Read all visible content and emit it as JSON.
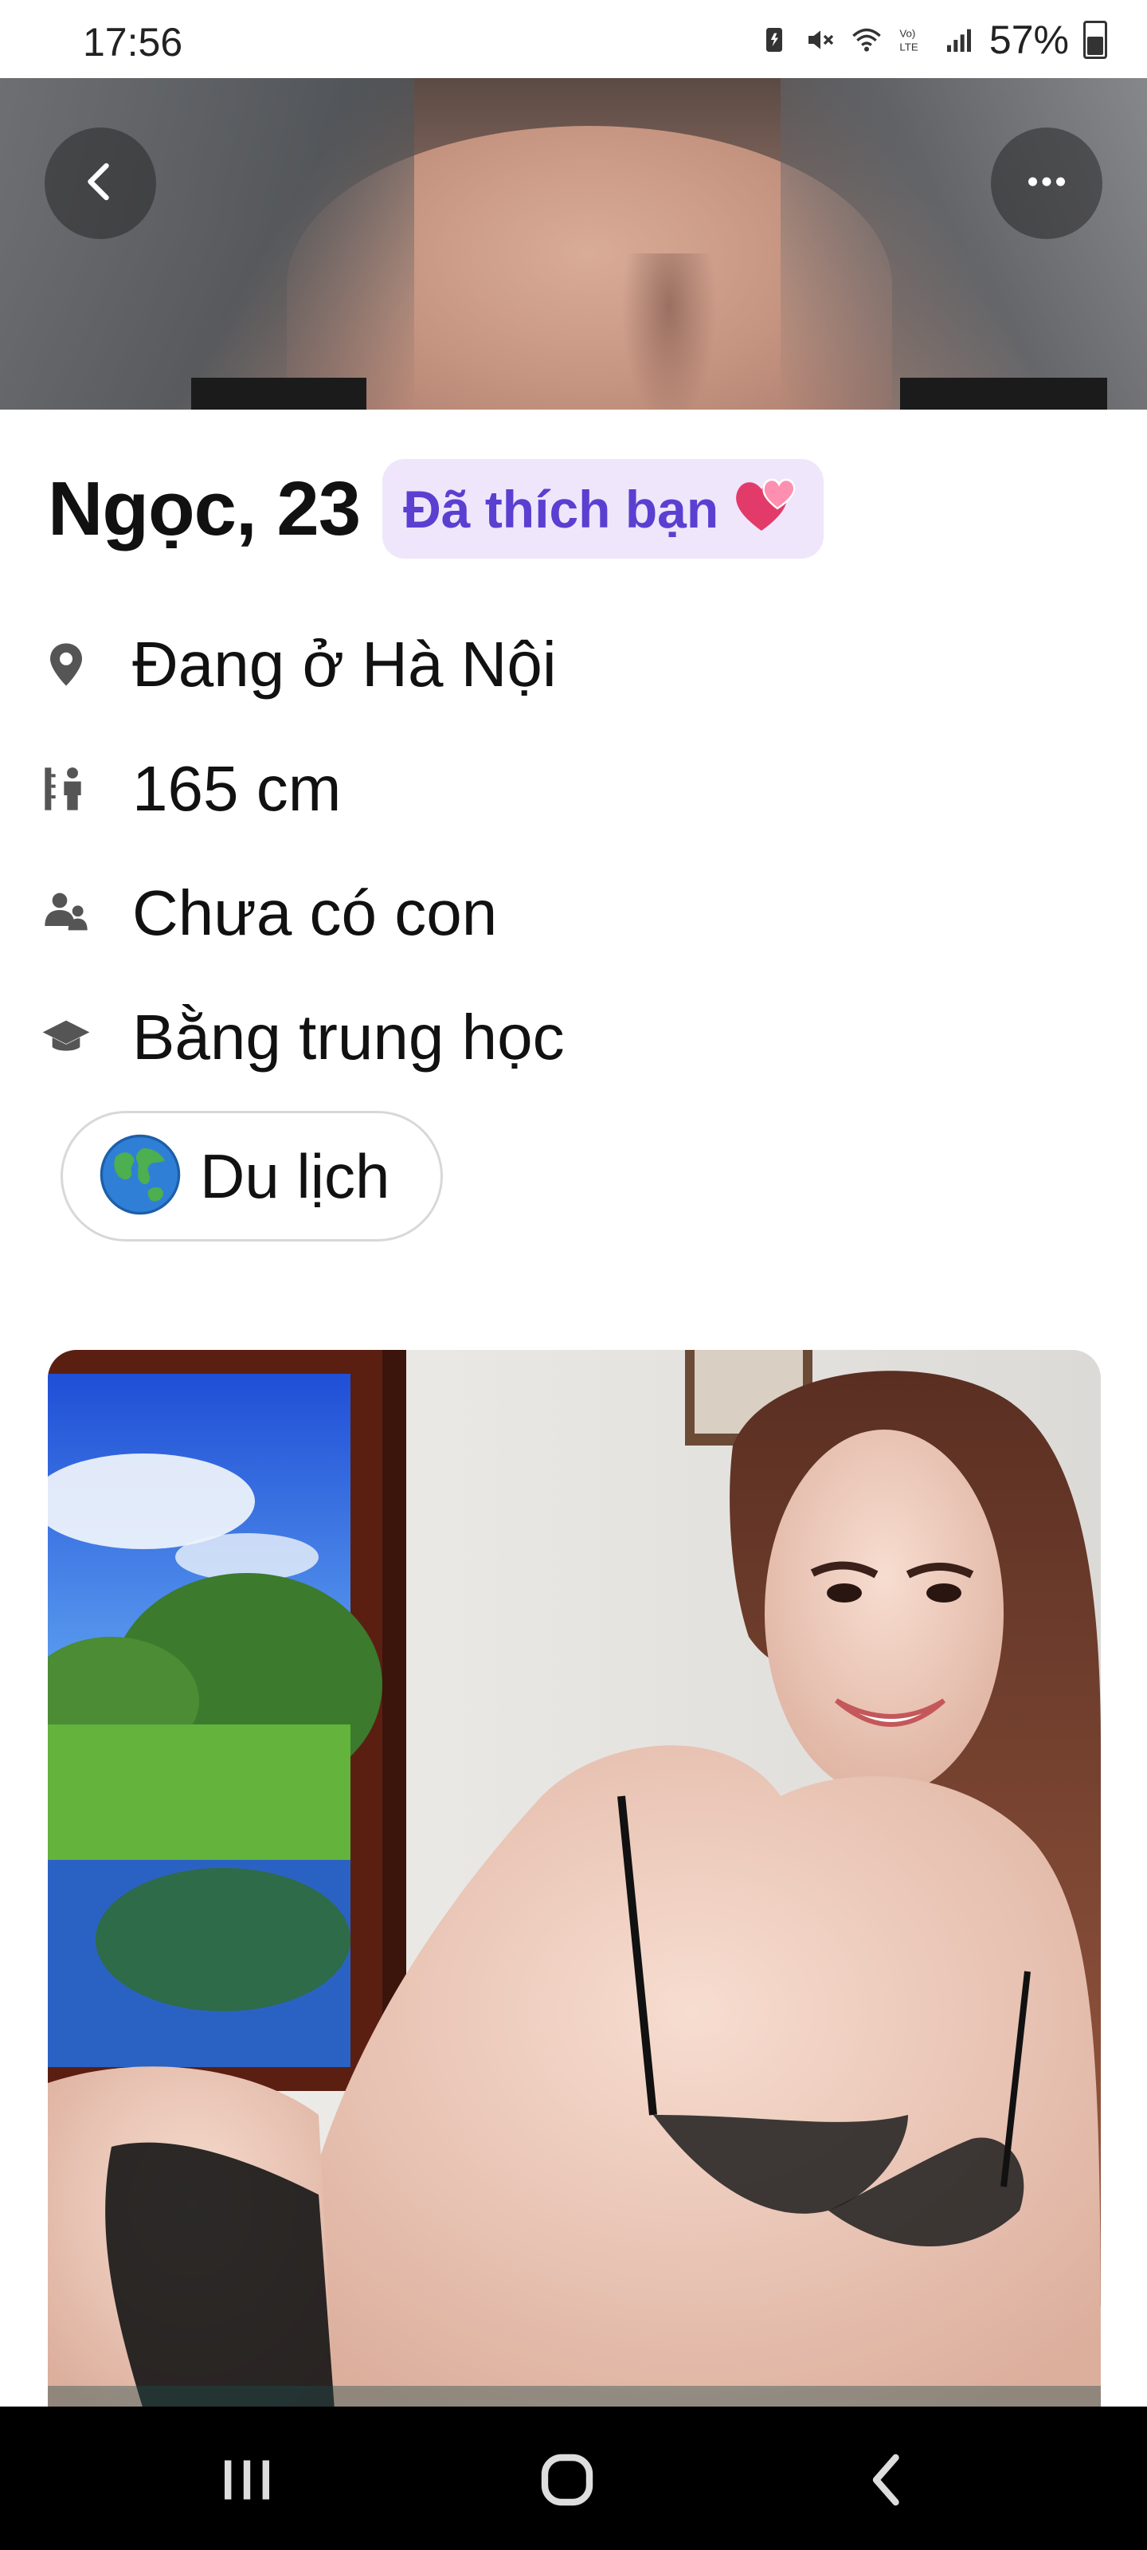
{
  "status_bar": {
    "time": "17:56",
    "battery_percent": "57%",
    "icons": [
      "battery-saver-icon",
      "mute-icon",
      "wifi-icon",
      "volte-icon",
      "signal-icon",
      "battery-icon"
    ]
  },
  "header_photo": {
    "back_icon": "chevron-left-icon",
    "more_icon": "more-horizontal-icon"
  },
  "profile": {
    "name_age": "Ngọc, 23",
    "liked_badge": "Đã thích bạn",
    "liked_icon": "two-hearts-icon",
    "details": [
      {
        "icon": "location-pin-icon",
        "text": "Đang ở Hà Nội"
      },
      {
        "icon": "height-icon",
        "text": "165 cm"
      },
      {
        "icon": "children-icon",
        "text": "Chưa có con"
      },
      {
        "icon": "graduation-cap-icon",
        "text": "Bằng trung học"
      }
    ],
    "interests": [
      {
        "icon": "globe-icon",
        "label": "Du lịch"
      }
    ]
  },
  "nav_bar": {
    "recent_icon": "recent-apps-icon",
    "home_icon": "home-icon",
    "back_icon": "back-icon"
  },
  "colors": {
    "accent": "#5b3fd1",
    "badge_bg": "#efe6fb",
    "nav_bg": "#000000"
  }
}
